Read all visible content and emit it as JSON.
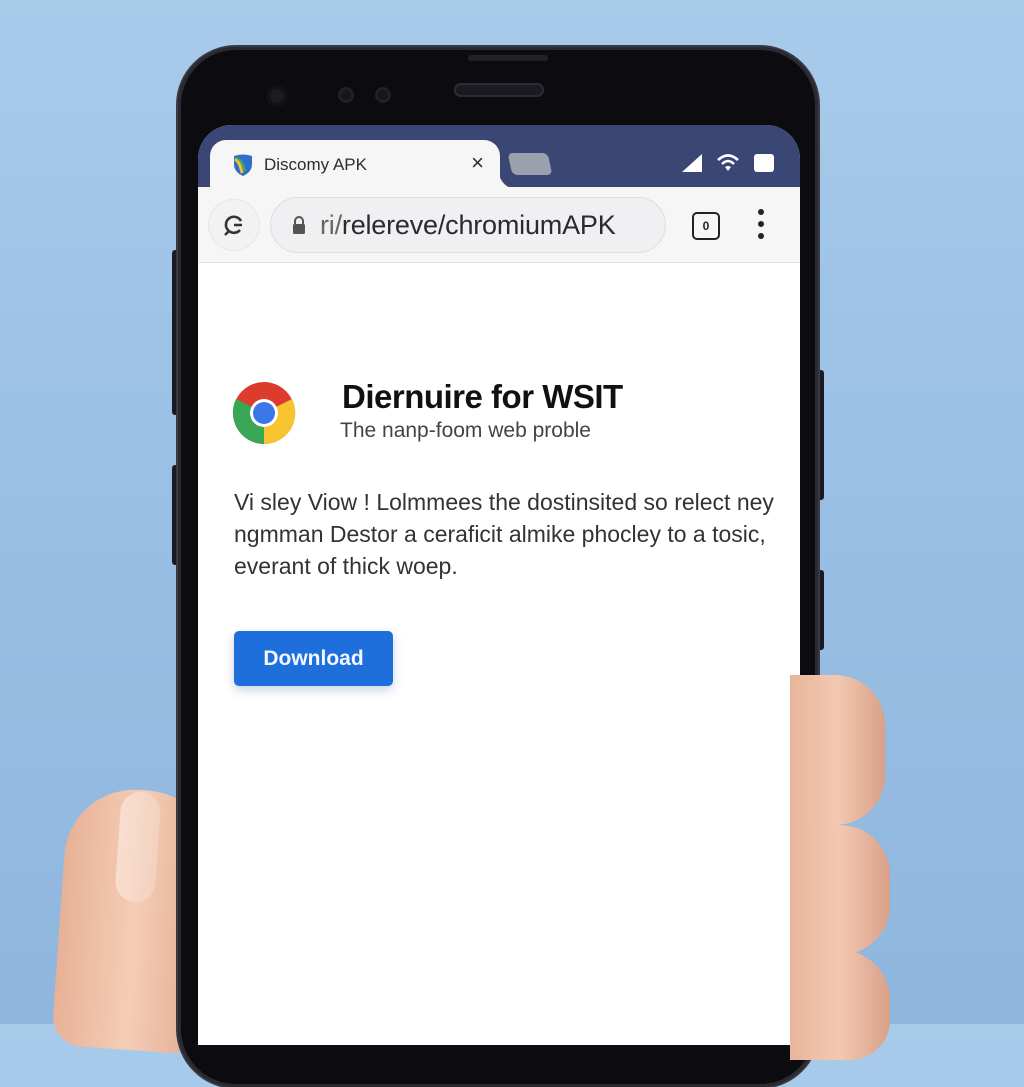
{
  "browser": {
    "tab": {
      "title": "Discomy APK",
      "close_icon": "×"
    },
    "status_bar": {
      "icons": [
        "signal-icon",
        "wifi-icon",
        "battery-icon"
      ]
    },
    "toolbar": {
      "reload_icon": "reload-icon",
      "url_prefix": "ri/",
      "url_rest": "relereve/chromiumAPK",
      "tab_count": "0",
      "menu_icon": "more-vert-icon"
    }
  },
  "page": {
    "app_title": "Diernuire for WSIT",
    "app_subtitle": "The nanp-foom web proble",
    "description": "Vi sley Viow ! Lolmmees the dostinsited so relect ney ngmman Destor a ceraficit almike phocley to a tosic, everant of thick woep.",
    "download_label": "Download",
    "accent_color": "#1e6fdc"
  }
}
